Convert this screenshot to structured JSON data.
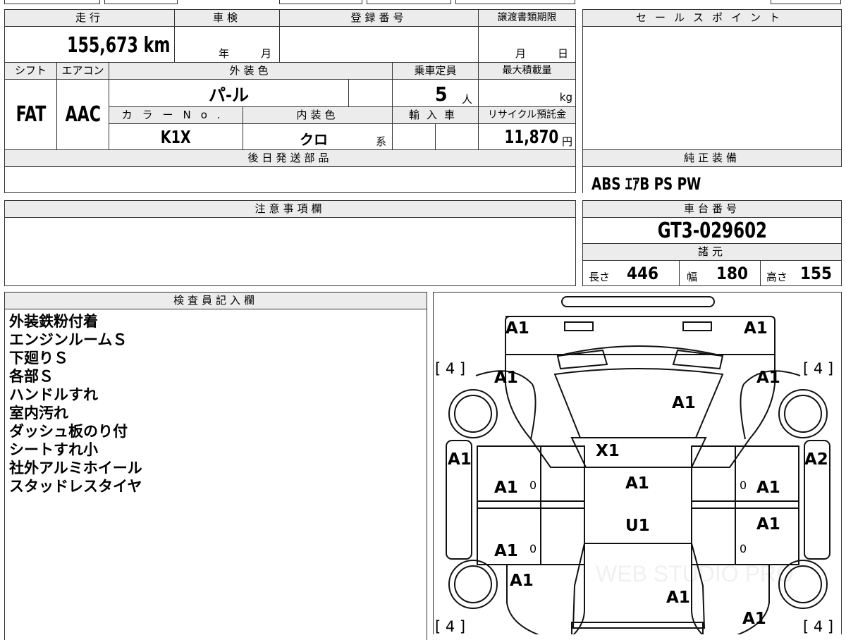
{
  "top": {
    "mileage_header": "走行",
    "mileage_value": "155,673 km",
    "shaken_header": "車検",
    "shaken_year": "年",
    "shaken_month": "月",
    "reg_header": "登録番号",
    "transfer_header": "譲渡書類期限",
    "transfer_month": "月",
    "transfer_day": "日",
    "shift_header": "シフト",
    "shift_value": "FAT",
    "ac_header": "エアコン",
    "ac_value": "AAC",
    "ext_color_header": "外装色",
    "ext_color_value": "パ-ル",
    "capacity_header": "乗車定員",
    "capacity_value": "5",
    "capacity_unit": "人",
    "maxload_header": "最大積載量",
    "maxload_unit": "kg",
    "color_no_header": "カラーNo.",
    "color_no_value": "K1X",
    "int_color_header": "内装色",
    "int_color_value": "クロ",
    "int_color_suffix": "系",
    "import_header": "輸入車",
    "recycle_header": "リサイクル預託金",
    "recycle_value": "11,870",
    "recycle_unit": "円",
    "later_parts_header": "後日発送部品"
  },
  "sales_point": {
    "header": "セールスポイント"
  },
  "factory_equipment": {
    "header": "純正装備",
    "value": "ABS ｴｱB PS PW"
  },
  "caution": {
    "header": "注意事項欄"
  },
  "chassis": {
    "header": "車台番号",
    "value": "GT3-029602"
  },
  "specs": {
    "header": "諸元",
    "length_label": "長さ",
    "length_value": "446",
    "width_label": "幅",
    "width_value": "180",
    "height_label": "高さ",
    "height_value": "155"
  },
  "inspector": {
    "header": "検査員記入欄",
    "notes": [
      "外装鉄粉付着",
      "エンジンルームＳ",
      "下廻りＳ",
      "各部Ｓ",
      "ハンドルすれ",
      "室内汚れ",
      "ダッシュ板のり付",
      "シートすれ小",
      "社外アルミホイール",
      "スタッドレスタイヤ"
    ]
  },
  "diagram": {
    "tire_marks": [
      "[ 4 ]",
      "[ 4 ]",
      "[ 4 ]",
      "[ 4 ]"
    ],
    "zero_mark": "0",
    "watermark": "WEB STUDIO PRO",
    "labels": {
      "front_left_corner": "A1",
      "front_right_corner": "A1",
      "front_left_fender": "A1",
      "front_right_fender": "A1",
      "hood": "A1",
      "windshield": "X1",
      "left_rocker": "A1",
      "right_rocker": "A2",
      "front_left_door": "A1",
      "front_right_door": "A1",
      "roof": "A1",
      "roof_rear": "U1",
      "rear_right_door": "A1",
      "rear_left_door": "A1",
      "rear_left_quarter": "A1",
      "trunk": "A1",
      "rear_right_quarter": "A1"
    }
  }
}
